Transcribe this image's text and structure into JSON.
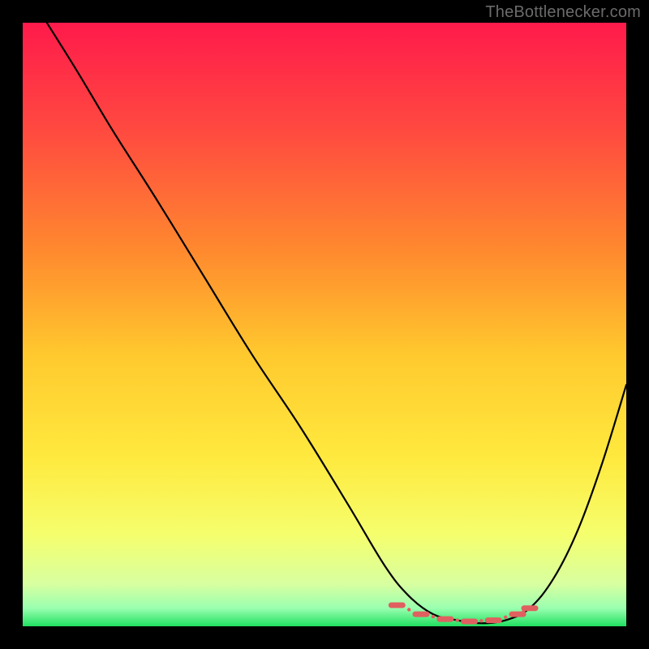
{
  "attribution": "TheBottlenecker.com",
  "colors": {
    "gradient_top": "#ff1a4b",
    "gradient_mid_upper": "#ff6a3a",
    "gradient_mid": "#ffd23a",
    "gradient_lower": "#f8ff66",
    "gradient_near_bottom": "#d8ffa0",
    "gradient_bottom": "#20e060",
    "curve": "#000000",
    "marker": "#e06060",
    "background": "#000000"
  },
  "chart_data": {
    "type": "line",
    "title": "",
    "xlabel": "",
    "ylabel": "",
    "xlim": [
      0,
      100
    ],
    "ylim": [
      0,
      100
    ],
    "series": [
      {
        "name": "bottleneck-curve",
        "x": [
          4,
          9,
          15,
          22,
          30,
          38,
          46,
          54,
          60,
          64,
          68,
          72,
          76,
          80,
          84,
          88,
          92,
          96,
          100
        ],
        "y": [
          100,
          92,
          82,
          71,
          58,
          45,
          33,
          20,
          10,
          5,
          2,
          1,
          0.5,
          1,
          3,
          8,
          16,
          27,
          40
        ]
      }
    ],
    "markers": {
      "name": "optimal-range",
      "x": [
        62,
        66,
        70,
        74,
        78,
        82,
        84
      ],
      "y": [
        3.5,
        2.0,
        1.2,
        0.8,
        1.0,
        2.0,
        3.0
      ]
    },
    "notes": "x and y are in percent of plot width/height; values estimated from pixels"
  }
}
